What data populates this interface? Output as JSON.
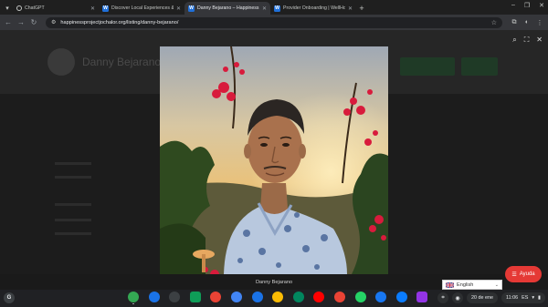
{
  "tabs": [
    {
      "title": "ChatGPT",
      "favicon": "chatgpt-icon",
      "active": false
    },
    {
      "title": "Discover Local Experiences & ",
      "favicon": "wp-icon",
      "active": false
    },
    {
      "title": "Danny Bejarano – Happiness P",
      "favicon": "wp-icon",
      "active": true
    },
    {
      "title": "Provider Onboarding | WellHo",
      "favicon": "wp-icon",
      "active": false
    }
  ],
  "toolbar": {
    "url": "happinessprojectjochalor.org/listing/danny-bejarano/"
  },
  "page": {
    "bg_name": "Danny Bejarano"
  },
  "lightbox": {
    "caption": "Danny Bejarano"
  },
  "language": {
    "selected": "English"
  },
  "help": {
    "label": "Ayuda"
  },
  "shelf": {
    "launcher_label": "G",
    "apps": [
      {
        "name": "chrome-icon",
        "color": "#34a853"
      },
      {
        "name": "add-icon",
        "color": "#1a73e8"
      },
      {
        "name": "cast-icon",
        "color": "#3c4043"
      },
      {
        "name": "apps-grid-icon",
        "color": "#0f9d58"
      },
      {
        "name": "gmail-icon",
        "color": "#ea4335"
      },
      {
        "name": "docs-icon",
        "color": "#4285f4"
      },
      {
        "name": "chat-icon",
        "color": "#1a73e8"
      },
      {
        "name": "photos-icon",
        "color": "#fbbc04"
      },
      {
        "name": "play-store-icon",
        "color": "#01875f"
      },
      {
        "name": "youtube-icon",
        "color": "#ff0000"
      },
      {
        "name": "photos-pinwheel-icon",
        "color": "#ea4335"
      },
      {
        "name": "whatsapp-icon",
        "color": "#25d366"
      },
      {
        "name": "facebook-icon",
        "color": "#1877f2"
      },
      {
        "name": "messenger-icon",
        "color": "#0a7cff"
      },
      {
        "name": "app-purple-icon",
        "color": "#9334e6"
      }
    ],
    "date": "20 de ene",
    "time": "11:06",
    "locale": "ES"
  }
}
